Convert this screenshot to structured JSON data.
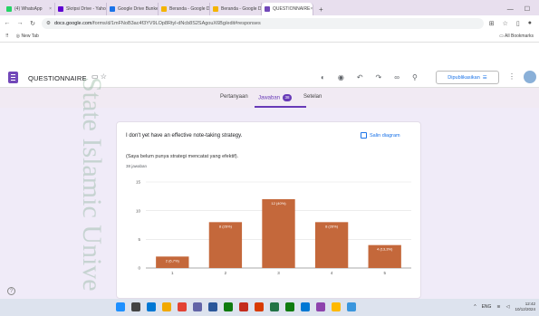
{
  "browser": {
    "tabs": [
      {
        "label": "(4) WhatsApp",
        "color": "#25d366",
        "active": false
      },
      {
        "label": "Skripsi Drive - Yahoo",
        "color": "#5f01d1",
        "active": false
      },
      {
        "label": "Google Drive Bunker",
        "color": "#1a73e8",
        "active": false
      },
      {
        "label": "Beranda - Google Dr",
        "color": "#f4b400",
        "active": false
      },
      {
        "label": "Beranda - Google Dr",
        "color": "#f4b400",
        "active": false
      },
      {
        "label": "QUESTIONNAIRE",
        "color": "#7248b9",
        "active": true
      }
    ],
    "new_tab": "+",
    "url_host": "docs.google.com",
    "url_path": "/forms/d/1mFNoB3ac4f3YV9LOp8Rtyl-dNcb8S2SAgouX6Bg/edit#responses",
    "bookmark_first": "New Tab",
    "bookmark_all": "All Bookmarks"
  },
  "form": {
    "title": "QUESTIONNAIRE",
    "publish_label": "Dipublikasikan",
    "tabs": {
      "questions": "Pertanyaan",
      "responses": "Jawaban",
      "responses_count": "38",
      "settings": "Setelan"
    }
  },
  "question": {
    "title": "I don't yet have an effective note-taking strategy.",
    "copy_label": "Salin diagram",
    "translation": "(Saya belum punya strategi mencatat yang efektif).",
    "response_count": "38 jawaban"
  },
  "chart_data": {
    "type": "bar",
    "categories": [
      "1",
      "2",
      "3",
      "4",
      "5"
    ],
    "values": [
      2,
      8,
      12,
      8,
      4
    ],
    "data_labels": [
      "2 (6,7%)",
      "8 (26%)",
      "12 (40%)",
      "8 (26%)",
      "4 (13,3%)"
    ],
    "yticks": [
      "0",
      "5",
      "10",
      "15"
    ],
    "ylim": [
      0,
      15
    ],
    "bar_color": "#c4683b"
  },
  "taskbar": {
    "lang": "ENG",
    "time": "12:42",
    "date": "10/12/2024"
  },
  "colors": {
    "accent": "#673ab7",
    "link": "#1a73e8",
    "bar": "#c4683b"
  }
}
